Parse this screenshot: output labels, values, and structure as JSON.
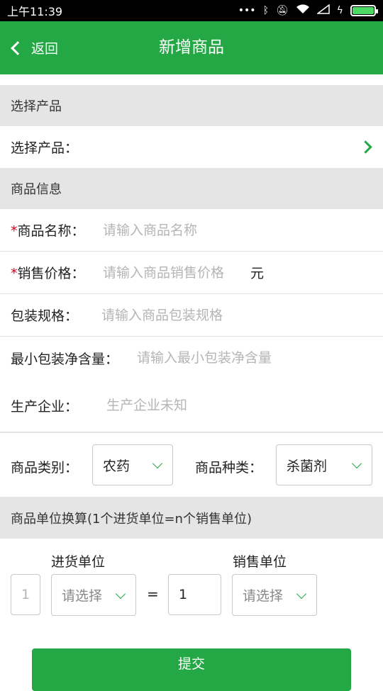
{
  "status": {
    "time": "上午11:39",
    "icons": [
      "dots-icon",
      "bluetooth-icon",
      "mute-icon",
      "wifi-icon",
      "signal-icon",
      "charging-icon",
      "battery-icon"
    ]
  },
  "header": {
    "back_label": "返回",
    "title": "新增商品"
  },
  "colors": {
    "accent": "#24a845",
    "required": "#d0021b",
    "section_bg": "#e5e5e5"
  },
  "section_product": {
    "title": "选择产品"
  },
  "product_row": {
    "label": "选择产品："
  },
  "section_info": {
    "title": "商品信息"
  },
  "fields": {
    "name": {
      "required_mark": "*",
      "label": "商品名称：",
      "placeholder": "请输入商品名称"
    },
    "price": {
      "required_mark": "*",
      "label": "销售价格：",
      "placeholder": "请输入商品销售价格",
      "unit": "元"
    },
    "package": {
      "label": "包装规格：",
      "placeholder": "请输入商品包装规格"
    },
    "min_content": {
      "label": "最小包装净含量：",
      "placeholder": "请输入最小包装净含量"
    },
    "manufacturer": {
      "label": "生产企业：",
      "placeholder": "生产企业未知"
    }
  },
  "category": {
    "label": "商品类别：",
    "value": "农药"
  },
  "kind": {
    "label": "商品种类：",
    "value": "杀菌剂"
  },
  "section_unit": {
    "title": "商品单位换算(1个进货单位=n个销售单位)"
  },
  "unit_conversion": {
    "purchase_label": "进货单位",
    "sales_label": "销售单位",
    "purchase_qty": "1",
    "purchase_select": "请选择",
    "equals": "=",
    "sales_qty": "1",
    "sales_select": "请选择"
  },
  "submit_label": "提交"
}
